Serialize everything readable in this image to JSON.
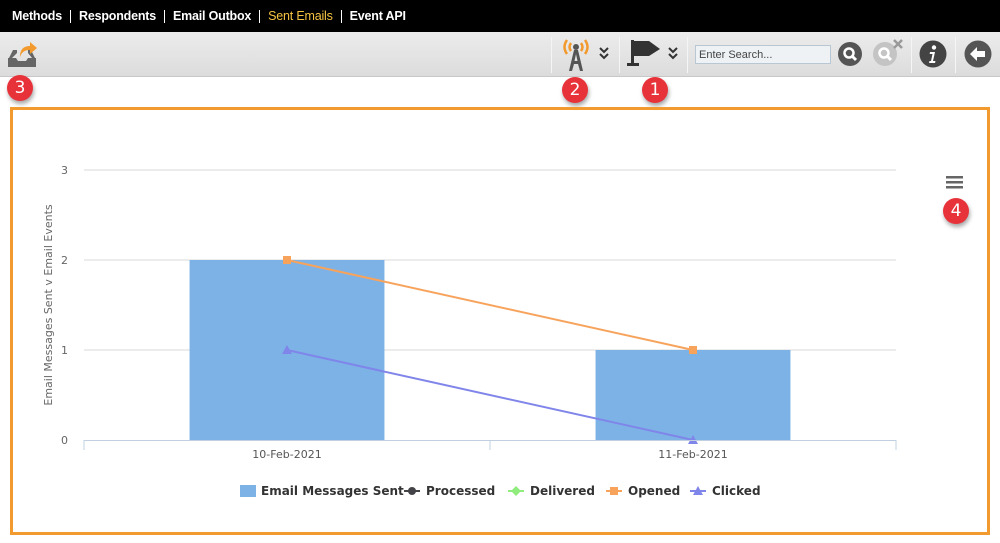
{
  "topnav": {
    "items": [
      {
        "label": "Methods",
        "active": false
      },
      {
        "label": "Respondents",
        "active": false
      },
      {
        "label": "Email Outbox",
        "active": false
      },
      {
        "label": "Sent Emails",
        "active": true
      },
      {
        "label": "Event API",
        "active": false
      }
    ]
  },
  "toolbar": {
    "left_icon": "export-inbox-icon",
    "search": {
      "placeholder": "Enter Search...",
      "value": ""
    },
    "icons": [
      "broadcast-tower-icon",
      "double-chevron-down-icon",
      "flag-icon",
      "double-chevron-down-icon",
      "search-icon",
      "clear-search-icon",
      "info-icon",
      "back-arrow-icon"
    ],
    "accent_color": "#f39a2e"
  },
  "badges": {
    "b1": "1",
    "b2": "2",
    "b3": "3",
    "b4": "4"
  },
  "chart_menu_icon": "hamburger-menu-icon",
  "chart_data": {
    "type": "bar",
    "title": "",
    "xlabel": "",
    "ylabel": "Email Messages Sent v Email Events",
    "categories": [
      "10-Feb-2021",
      "11-Feb-2021"
    ],
    "ylim": [
      0,
      3
    ],
    "yticks": [
      "0",
      "1",
      "2",
      "3"
    ],
    "grid": true,
    "legend_position": "bottom",
    "series": [
      {
        "name": "Email Messages Sent",
        "kind": "bar",
        "color": "#7cb2e6",
        "marker": "square",
        "values": [
          2,
          1
        ]
      },
      {
        "name": "Processed",
        "kind": "line",
        "color": "#434348",
        "marker": "circle",
        "values": [
          null,
          null
        ]
      },
      {
        "name": "Delivered",
        "kind": "line",
        "color": "#90ed7d",
        "marker": "diamond",
        "values": [
          null,
          null
        ]
      },
      {
        "name": "Opened",
        "kind": "line",
        "color": "#f7a35c",
        "marker": "square",
        "values": [
          2,
          1
        ]
      },
      {
        "name": "Clicked",
        "kind": "line",
        "color": "#8085e9",
        "marker": "triangle",
        "values": [
          1,
          0
        ]
      }
    ]
  }
}
